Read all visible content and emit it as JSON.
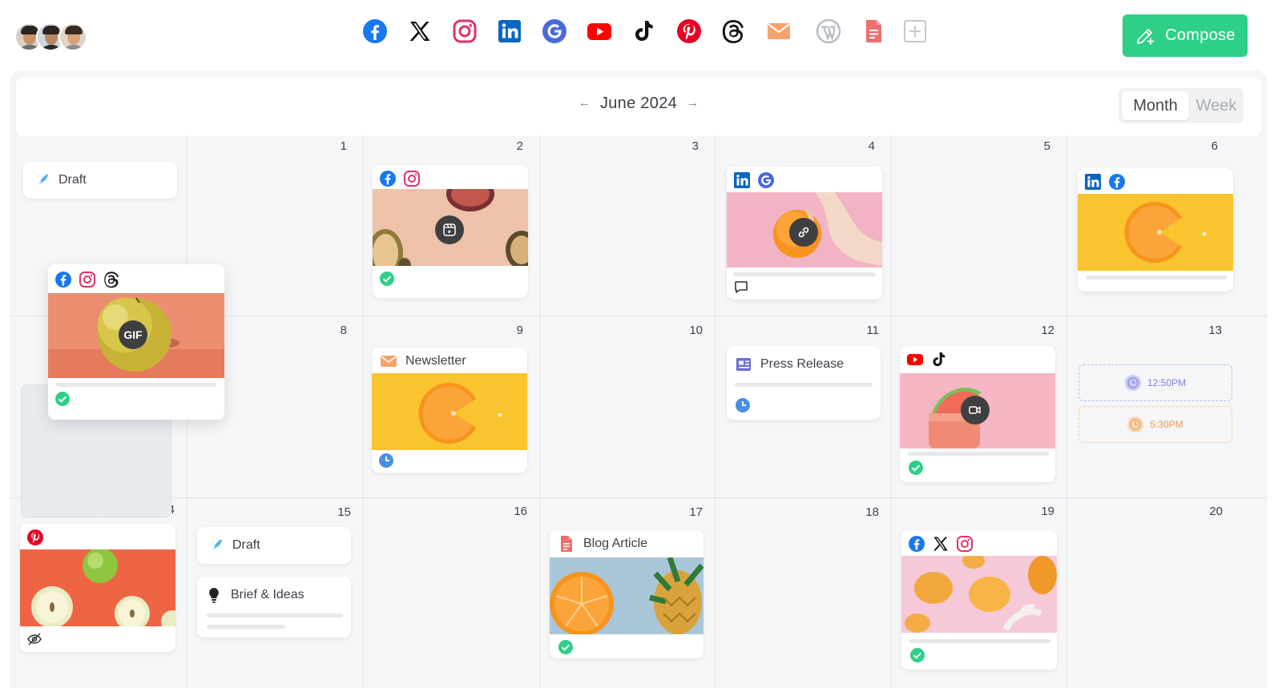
{
  "topbar": {
    "avatars": [
      "avatar-1",
      "avatar-2",
      "avatar-3"
    ],
    "channels": [
      {
        "name": "facebook-icon",
        "color": "#1877f2"
      },
      {
        "name": "x-icon",
        "color": "#111111"
      },
      {
        "name": "instagram-icon",
        "color": "#e1306c"
      },
      {
        "name": "linkedin-icon",
        "color": "#0a66c2"
      },
      {
        "name": "google-icon",
        "color": "#4a6ad8"
      },
      {
        "name": "youtube-icon",
        "color": "#ff0000"
      },
      {
        "name": "tiktok-icon",
        "color": "#111111"
      },
      {
        "name": "pinterest-icon",
        "color": "#e60023"
      },
      {
        "name": "threads-icon",
        "color": "#111111"
      },
      {
        "name": "email-icon",
        "color": "#f5a36b"
      },
      {
        "name": "wordpress-icon",
        "color": "#b6bcc4"
      },
      {
        "name": "document-icon",
        "color": "#ef6f6f"
      },
      {
        "name": "add-channel-icon",
        "color": "#c5c9ce"
      }
    ],
    "compose_label": "Compose"
  },
  "calendar": {
    "month_label": "June 2024",
    "views": {
      "month": "Month",
      "week": "Week",
      "active": "Month"
    },
    "days": [
      "1",
      "2",
      "3",
      "4",
      "5",
      "6",
      "8",
      "9",
      "10",
      "11",
      "12",
      "13",
      "14",
      "15",
      "16",
      "17",
      "18",
      "19",
      "20"
    ]
  },
  "posts": {
    "draft_1": {
      "title": "Draft"
    },
    "day2": {
      "channels": [
        "facebook",
        "instagram"
      ],
      "status": "published",
      "media": "reel"
    },
    "day4": {
      "channels": [
        "linkedin",
        "google"
      ],
      "media": "link",
      "status": "comment"
    },
    "day6": {
      "channels": [
        "linkedin",
        "facebook"
      ]
    },
    "dragging": {
      "channels": [
        "facebook",
        "instagram",
        "threads"
      ],
      "badge": "GIF",
      "status": "published"
    },
    "newsletter": {
      "title": "Newsletter",
      "status": "scheduled"
    },
    "press_release": {
      "title": "Press Release",
      "status": "scheduled"
    },
    "day12": {
      "channels": [
        "youtube",
        "tiktok"
      ],
      "media": "video",
      "status": "published"
    },
    "slots": [
      {
        "time": "12:50PM",
        "color": "#8b8fe6"
      },
      {
        "time": "5:30PM",
        "color": "#f2a75a"
      }
    ],
    "day14": {
      "channels": [
        "pinterest"
      ],
      "status": "hidden"
    },
    "draft_2": {
      "title": "Draft"
    },
    "brief": {
      "title": "Brief & Ideas"
    },
    "blog": {
      "title": "Blog Article",
      "status": "published"
    },
    "day19": {
      "channels": [
        "facebook",
        "x",
        "instagram"
      ],
      "status": "published"
    }
  },
  "colors": {
    "accent": "#2ecf87",
    "published": "#2ecf87",
    "scheduled": "#4a90e2",
    "background": "#f5f6f8"
  }
}
